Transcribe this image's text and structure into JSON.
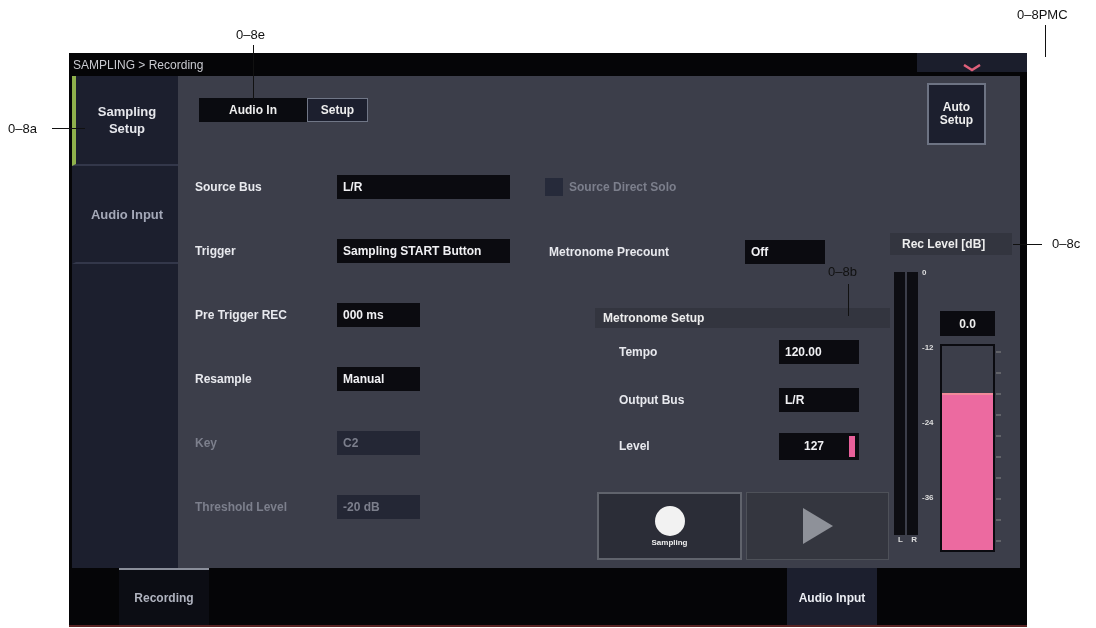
{
  "callouts": [
    {
      "label": "0–8e"
    },
    {
      "label": "0–8PMC"
    },
    {
      "label": "0–8a"
    },
    {
      "label": "0–8c"
    },
    {
      "label": "0–8b"
    }
  ],
  "header": {
    "breadcrumb": "SAMPLING > Recording"
  },
  "sidebar": {
    "items": [
      {
        "label": "Sampling Setup",
        "selected": true
      },
      {
        "label": "Audio Input",
        "selected": false
      }
    ]
  },
  "section": {
    "title": "Audio In",
    "button": "Setup"
  },
  "auto_setup": "Auto Setup",
  "fields": [
    {
      "label": "Source Bus",
      "value": "L/R",
      "disabled": false
    },
    {
      "label": "Trigger",
      "value": "Sampling START Button",
      "disabled": false
    },
    {
      "label": "Pre Trigger REC",
      "value": "000 ms",
      "disabled": false
    },
    {
      "label": "Resample",
      "value": "Manual",
      "disabled": false
    },
    {
      "label": "Key",
      "value": "C2",
      "disabled": true
    },
    {
      "label": "Threshold Level",
      "value": "-20 dB",
      "disabled": true
    }
  ],
  "source_direct_solo": {
    "label": "Source Direct Solo",
    "checked": false,
    "disabled": true
  },
  "metronome_precount": {
    "label": "Metronome Precount",
    "value": "Off"
  },
  "metronome_setup": {
    "title": "Metronome Setup",
    "fields": [
      {
        "kind": "text",
        "label": "Tempo",
        "value": "120.00"
      },
      {
        "kind": "text",
        "label": "Output Bus",
        "value": "L/R"
      },
      {
        "kind": "level",
        "label": "Level",
        "value": "127",
        "level": 1.0
      }
    ]
  },
  "transport": {
    "record_label": "Sampling"
  },
  "rec_level": {
    "title": "Rec Level [dB]",
    "scale": [
      "0",
      "-12",
      "-24",
      "-36"
    ],
    "meter_labels": [
      "L",
      "R"
    ],
    "value": "0.0",
    "level": 0.77
  },
  "bottom_tabs": [
    {
      "label": "Recording",
      "selected": true
    },
    {
      "label": "Audio Input",
      "selected": false
    }
  ]
}
